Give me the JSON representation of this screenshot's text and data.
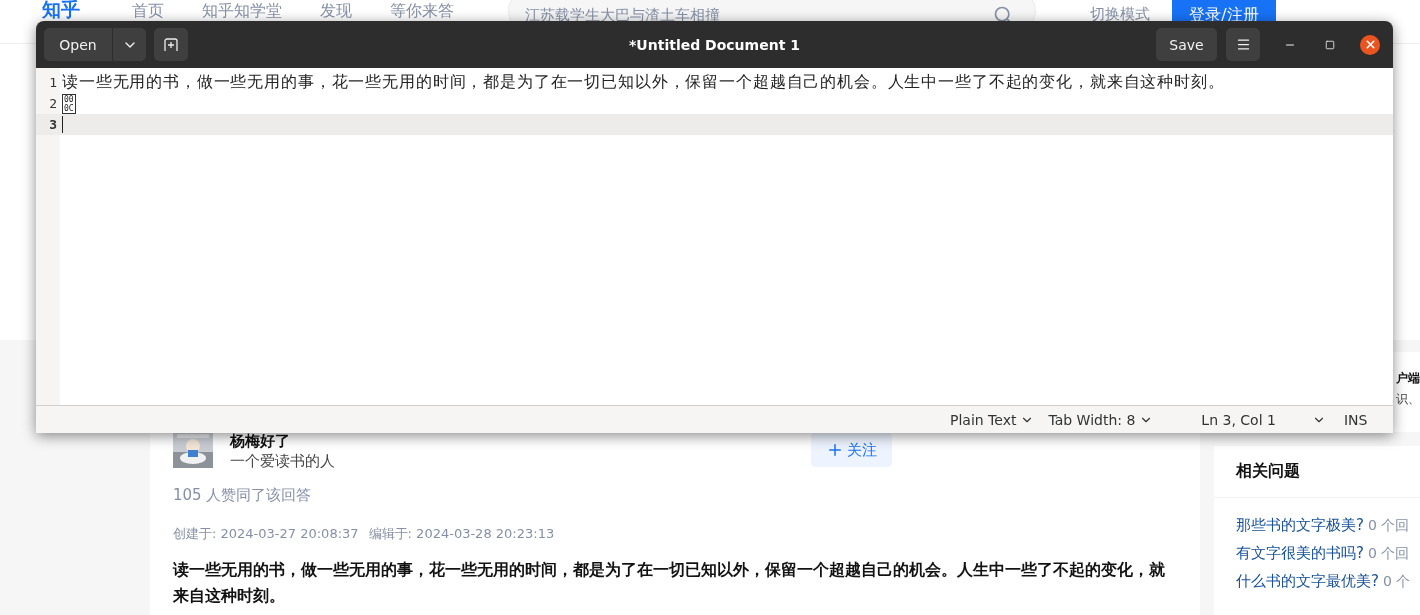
{
  "site_header": {
    "logo": "知乎",
    "nav": [
      "首页",
      "知乎知学堂",
      "发现",
      "等你来答"
    ],
    "search": {
      "placeholder": "江苏载学生大巴与渣土车相撞"
    },
    "mode_switch": "切换模式",
    "login_button": "登录/注册"
  },
  "client_card": {
    "title": "户端",
    "text": "识、"
  },
  "answer": {
    "author": "杨梅好了",
    "bio": "一个爱读书的人",
    "follow": "关注",
    "votes": "105 人赞同了该回答",
    "created": "创建于: 2024-03-27 20:08:37",
    "edited": "编辑于: 2024-03-28 20:23:13",
    "body": "读一些无用的书，做一些无用的事，花一些无用的时间，都是为了在一切已知以外，保留一个超越自己的机会。人生中一些了不起的变化，就来自这种时刻。"
  },
  "related": {
    "title": "相关问题",
    "items": [
      {
        "question": "那些书的文字极美?",
        "answers": "0 个回"
      },
      {
        "question": "有文字很美的书吗?",
        "answers": "0 个回"
      },
      {
        "question": "什么书的文字最优美?",
        "answers": "0 个"
      }
    ]
  },
  "editor": {
    "title": "*Untitled Document 1",
    "open": "Open",
    "save": "Save",
    "lines": [
      {
        "number": "1",
        "kind": "text",
        "text": "读一些无用的书，做一些无用的事，花一些无用的时间，都是为了在一切已知以外，保留一个超越自己的机会。人生中一些了不起的变化，就来自这种时刻。",
        "current": false
      },
      {
        "number": "2",
        "kind": "control_char",
        "code_rows": [
          "00",
          "0C"
        ],
        "current": false
      },
      {
        "number": "3",
        "kind": "text",
        "current": true
      }
    ],
    "status": {
      "language": "Plain Text",
      "tab_width": "Tab Width: 8",
      "position": "Ln 3, Col 1",
      "mode": "INS"
    }
  }
}
